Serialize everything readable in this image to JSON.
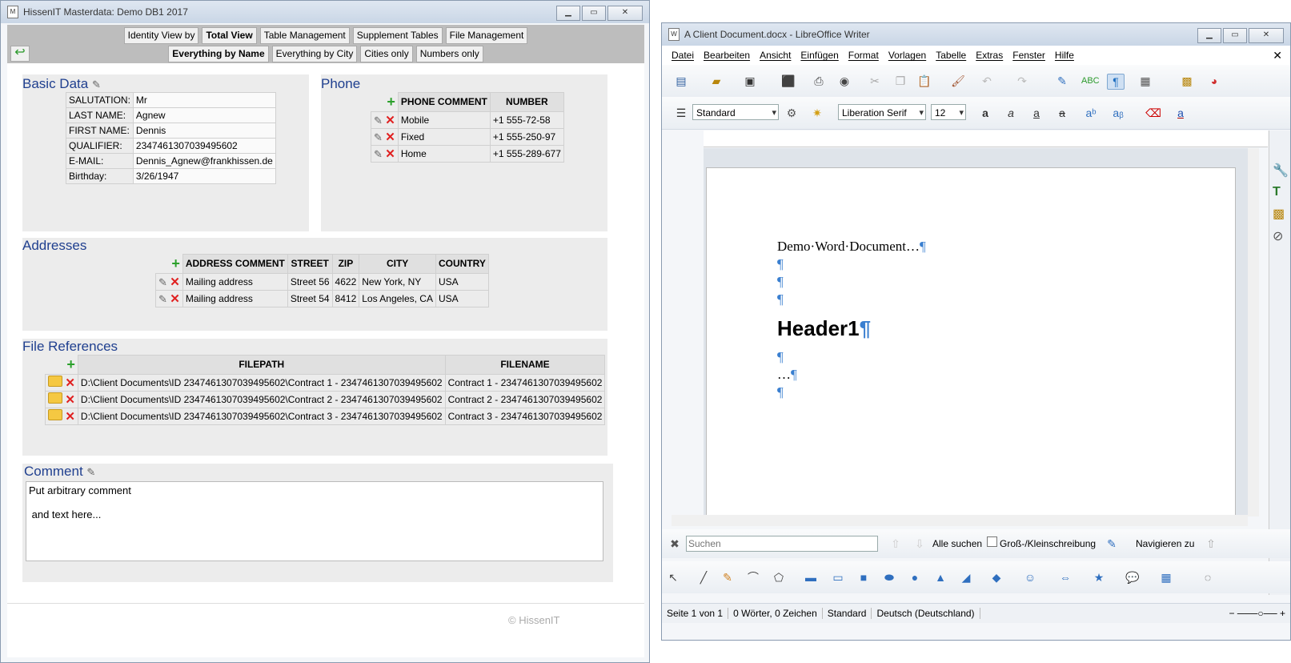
{
  "left_app": {
    "title": "HissenIT Masterdata: Demo DB1 2017",
    "nav_top": [
      "Identity View by",
      "Total View",
      "Table Management",
      "Supplement Tables",
      "File Management"
    ],
    "nav_bottom": [
      "Everything by Name",
      "Everything by City",
      "Cities only",
      "Numbers only"
    ],
    "basic_data": {
      "title": "Basic Data",
      "rows": [
        {
          "label": "SALUTATION:",
          "value": "Mr"
        },
        {
          "label": "LAST NAME:",
          "value": "Agnew"
        },
        {
          "label": "FIRST NAME:",
          "value": "Dennis"
        },
        {
          "label": "QUALIFIER:",
          "value": "2347461307039495602"
        },
        {
          "label": "E-MAIL:",
          "value": "Dennis_Agnew@frankhissen.de"
        },
        {
          "label": "Birthday:",
          "value": "3/26/1947"
        }
      ]
    },
    "phone": {
      "title": "Phone",
      "headers": [
        "PHONE COMMENT",
        "NUMBER"
      ],
      "rows": [
        {
          "comment": "Mobile",
          "number": "+1 555-72-58"
        },
        {
          "comment": "Fixed",
          "number": "+1 555-250-97"
        },
        {
          "comment": "Home",
          "number": "+1 555-289-677"
        }
      ]
    },
    "addresses": {
      "title": "Addresses",
      "headers": [
        "ADDRESS COMMENT",
        "STREET",
        "ZIP",
        "CITY",
        "COUNTRY"
      ],
      "rows": [
        {
          "comment": "Mailing address",
          "street": "Street 56",
          "zip": "4622",
          "city": "New York, NY",
          "country": "USA"
        },
        {
          "comment": "Mailing address",
          "street": "Street 54",
          "zip": "8412",
          "city": "Los Angeles, CA",
          "country": "USA"
        }
      ]
    },
    "file_references": {
      "title": "File References",
      "headers": [
        "FILEPATH",
        "FILENAME"
      ],
      "rows": [
        {
          "path": "D:\\Client Documents\\ID 2347461307039495602\\Contract 1 - 2347461307039495602",
          "name": "Contract 1 - 2347461307039495602"
        },
        {
          "path": "D:\\Client Documents\\ID 2347461307039495602\\Contract 2 - 2347461307039495602",
          "name": "Contract 2 - 2347461307039495602"
        },
        {
          "path": "D:\\Client Documents\\ID 2347461307039495602\\Contract 3 - 2347461307039495602",
          "name": "Contract 3 - 2347461307039495602"
        }
      ]
    },
    "comment": {
      "title": "Comment",
      "text": "Put arbitrary comment\n\n and text here..."
    },
    "copyright": "© HissenIT"
  },
  "right_app": {
    "title": "A Client Document.docx - LibreOffice Writer",
    "menu": [
      "Datei",
      "Bearbeiten",
      "Ansicht",
      "Einfügen",
      "Format",
      "Vorlagen",
      "Tabelle",
      "Extras",
      "Fenster",
      "Hilfe"
    ],
    "para_style": "Standard",
    "font_name": "Liberation Serif",
    "font_size": "12",
    "document": {
      "line1": "Demo·Word·Document…",
      "heading": "Header1",
      "ellipsis": "…",
      "pilcrow": "¶"
    },
    "find": {
      "placeholder": "Suchen",
      "find_all": "Alle suchen",
      "match_case": "Groß-/Kleinschreibung",
      "navigate": "Navigieren zu"
    },
    "status": {
      "page": "Seite 1 von 1",
      "words": "0 Wörter, 0 Zeichen",
      "style": "Standard",
      "language": "Deutsch (Deutschland)"
    }
  },
  "colors": {
    "accent_title": "#1f3f8f",
    "delete_red": "#e02020",
    "add_green": "#2ba02b"
  }
}
